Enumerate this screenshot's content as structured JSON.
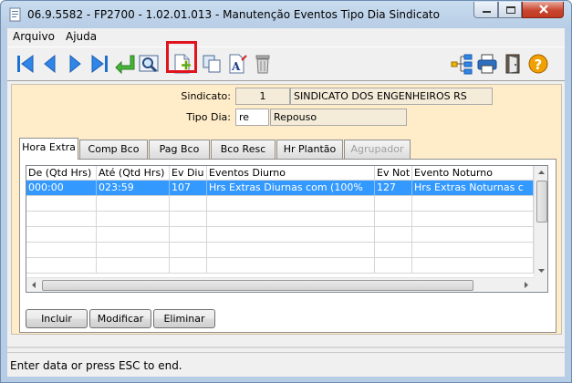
{
  "window": {
    "title": "06.9.5582 - FP2700 - 1.02.01.013 - Manutenção Eventos Tipo Dia Sindicato"
  },
  "menu": {
    "items": [
      {
        "label": "Arquivo"
      },
      {
        "label": "Ajuda"
      }
    ]
  },
  "toolbar": {
    "icons": [
      "first-record-icon",
      "previous-record-icon",
      "next-record-icon",
      "last-record-icon",
      "enter-icon",
      "search-icon",
      "new-record-icon",
      "copy-icon",
      "edit-text-icon",
      "delete-icon",
      "tree-icon",
      "print-icon",
      "exit-icon",
      "help-icon"
    ],
    "highlight_color": "#e0141e"
  },
  "header": {
    "sindicato_label": "Sindicato:",
    "sindicato_code": "1",
    "sindicato_name": "SINDICATO DOS ENGENHEIROS RS",
    "tipo_dia_label": "Tipo Dia:",
    "tipo_dia_code": "re",
    "tipo_dia_name": "Repouso"
  },
  "tabs": [
    {
      "label": "Hora Extra",
      "active": true
    },
    {
      "label": "Comp Bco"
    },
    {
      "label": "Pag Bco"
    },
    {
      "label": "Bco Resc"
    },
    {
      "label": "Hr Plantão"
    },
    {
      "label": "Agrupador",
      "disabled": true
    }
  ],
  "grid": {
    "columns": [
      "De (Qtd Hrs)",
      "Até (Qtd Hrs)",
      "Ev Diu",
      "Eventos Diurno",
      "Ev Not",
      "Evento Noturno"
    ],
    "rows": [
      [
        "000:00",
        "023:59",
        "107",
        "Hrs Extras Diurnas  com (100%",
        "127",
        "Hrs Extras Noturnas c"
      ]
    ]
  },
  "buttons": {
    "incluir": "Incluir",
    "modificar": "Modificar",
    "eliminar": "Eliminar"
  },
  "status": {
    "text": "Enter data or press ESC to end."
  },
  "colors": {
    "panel": "#ffecc9",
    "selection": "#3399ff"
  }
}
